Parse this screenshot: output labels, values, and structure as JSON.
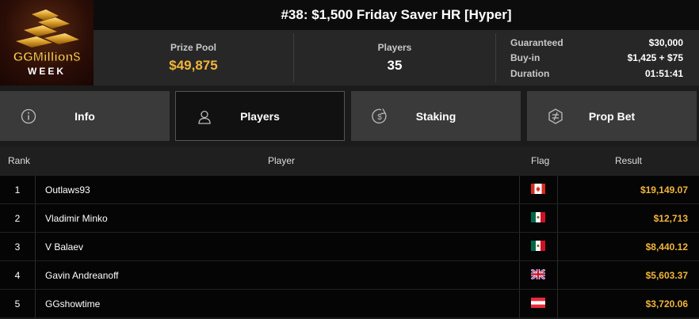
{
  "logo": {
    "name_text": "GGMillion$",
    "sub_text": "WEEK"
  },
  "tournament": {
    "title": "#38: $1,500 Friday Saver HR [Hyper]"
  },
  "stats": {
    "prize_pool_label": "Prize Pool",
    "prize_pool_value": "$49,875",
    "players_label": "Players",
    "players_value": "35",
    "guaranteed_label": "Guaranteed",
    "guaranteed_value": "$30,000",
    "buyin_label": "Buy-in",
    "buyin_value": "$1,425 + $75",
    "duration_label": "Duration",
    "duration_value": "01:51:41"
  },
  "tabs": [
    {
      "label": "Info",
      "icon": "info-icon",
      "active": false
    },
    {
      "label": "Players",
      "icon": "person-icon",
      "active": true
    },
    {
      "label": "Staking",
      "icon": "dollar-coin-icon",
      "active": false
    },
    {
      "label": "Prop Bet",
      "icon": "prop-bet-icon",
      "active": false
    }
  ],
  "table": {
    "headers": {
      "rank": "Rank",
      "player": "Player",
      "flag": "Flag",
      "result": "Result"
    },
    "rows": [
      {
        "rank": "1",
        "player": "Outlaws93",
        "flag": "canada",
        "result": "$19,149.07"
      },
      {
        "rank": "2",
        "player": "Vladimir Minko",
        "flag": "mexico",
        "result": "$12,713"
      },
      {
        "rank": "3",
        "player": "V Balaev",
        "flag": "mexico",
        "result": "$8,440.12"
      },
      {
        "rank": "4",
        "player": "Gavin Andreanoff",
        "flag": "united-kingdom",
        "result": "$5,603.37"
      },
      {
        "rank": "5",
        "player": "GGshowtime",
        "flag": "austria",
        "result": "$3,720.06"
      }
    ]
  },
  "colors": {
    "accent_gold": "#f2b53a",
    "header_bg": "#0c0c0c",
    "stats_bg": "#272727",
    "tab_bg": "#3a3a3a",
    "tab_active_bg": "#111111"
  }
}
